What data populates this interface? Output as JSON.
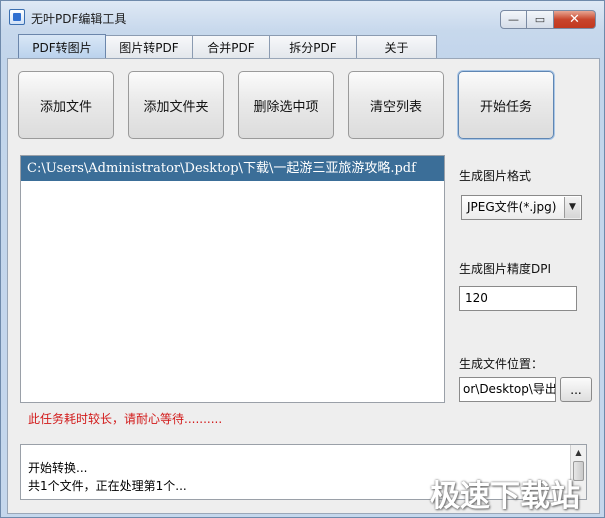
{
  "window": {
    "title": "无叶PDF编辑工具",
    "min_label": "—",
    "max_label": "▭",
    "close_label": "✕"
  },
  "tabs": [
    {
      "label": "PDF转图片",
      "active": true
    },
    {
      "label": "图片转PDF"
    },
    {
      "label": "合并PDF"
    },
    {
      "label": "拆分PDF"
    },
    {
      "label": "关于"
    }
  ],
  "toolbar": {
    "add_file": "添加文件",
    "add_folder": "添加文件夹",
    "delete_selected": "删除选中项",
    "clear_list": "清空列表",
    "start_task": "开始任务"
  },
  "file_list": {
    "items": [
      "C:\\Users\\Administrator\\Desktop\\下载\\一起游三亚旅游攻略.pdf"
    ]
  },
  "settings": {
    "format_label": "生成图片格式",
    "format_value": "JPEG文件(*.jpg)",
    "dpi_label": "生成图片精度DPI",
    "dpi_value": "120",
    "output_label": "生成文件位置：",
    "output_value": "or\\Desktop\\导出",
    "browse_label": "..."
  },
  "warning_text": "此任务耗时较长，请耐心等待..........",
  "log": {
    "lines": [
      "开始转换...",
      "共1个文件，正在处理第1个..."
    ]
  },
  "watermark": "极速下载站",
  "colors": {
    "selection": "#3b6e98",
    "warning": "#d21a1a",
    "close_button": "#c8452c"
  }
}
